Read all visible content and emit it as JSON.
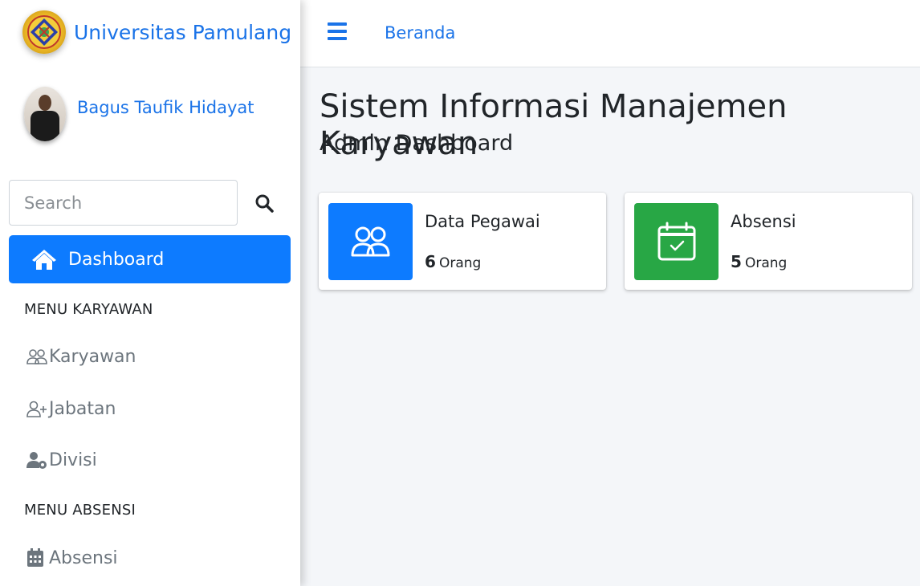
{
  "brand": {
    "name": "Universitas Pamulang",
    "logo_icon": "university-seal-icon"
  },
  "user": {
    "name": "Bagus Taufik Hidayat",
    "avatar_icon": "user-avatar-photo"
  },
  "search": {
    "placeholder": "Search",
    "icon": "search-icon"
  },
  "sidebar": {
    "active_item": {
      "label": "Dashboard",
      "icon": "home-icon"
    },
    "sections": [
      {
        "header": "MENU KARYAWAN",
        "items": [
          {
            "label": "Karyawan",
            "icon": "users-icon"
          },
          {
            "label": "Jabatan",
            "icon": "user-plus-icon"
          },
          {
            "label": "Divisi",
            "icon": "user-gear-icon"
          }
        ]
      },
      {
        "header": "MENU ABSENSI",
        "items": [
          {
            "label": "Absensi",
            "icon": "calendar-icon"
          }
        ]
      }
    ]
  },
  "topbar": {
    "menu_icon": "hamburger-icon",
    "breadcrumb": "Beranda"
  },
  "main": {
    "title": "Sistem Informasi Manajemen Karyawan",
    "subtitle": "Admin Dashboard",
    "cards": [
      {
        "title": "Data Pegawai",
        "count": "6",
        "unit": "Orang",
        "icon": "people-icon",
        "color": "#0d7bff"
      },
      {
        "title": "Absensi",
        "count": "5",
        "unit": "Orang",
        "icon": "calendar-check-icon",
        "color": "#28a745"
      }
    ]
  },
  "colors": {
    "primary": "#0d7bff",
    "link": "#1a73e8",
    "success": "#28a745",
    "background": "#f4f6f9"
  }
}
